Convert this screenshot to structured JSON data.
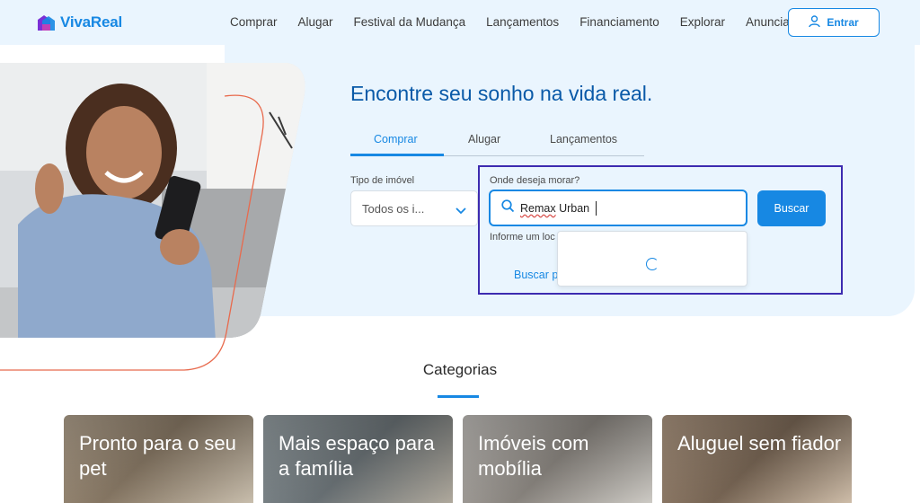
{
  "brand": {
    "name": "VivaReal",
    "colors": {
      "primary": "#1788e3",
      "title": "#0a5aa8",
      "hero_bg": "#eaf5fe",
      "highlight": "#3d2bb0"
    }
  },
  "nav": {
    "items": [
      "Comprar",
      "Alugar",
      "Festival da Mudança",
      "Lançamentos",
      "Financiamento",
      "Explorar",
      "Anunciar"
    ]
  },
  "login": {
    "label": "Entrar",
    "icon": "user-icon"
  },
  "hero": {
    "title": "Encontre seu sonho na vida real.",
    "tabs": [
      {
        "label": "Comprar",
        "active": true
      },
      {
        "label": "Alugar",
        "active": false
      },
      {
        "label": "Lançamentos",
        "active": false
      }
    ]
  },
  "search": {
    "property_type_label": "Tipo de imóvel",
    "property_type_value": "Todos os i...",
    "location_label": "Onde deseja morar?",
    "location_value_marked": "Remax",
    "location_value_rest": " Urban",
    "helper_text": "Informe um loc",
    "map_link": "Buscar p",
    "button": "Buscar",
    "dropdown_state": "loading"
  },
  "categories": {
    "title": "Categorias",
    "cards": [
      {
        "label": "Pronto para o seu pet"
      },
      {
        "label": "Mais espaço para a família"
      },
      {
        "label": "Imóveis com mobília"
      },
      {
        "label": "Aluguel sem fiador"
      }
    ]
  }
}
